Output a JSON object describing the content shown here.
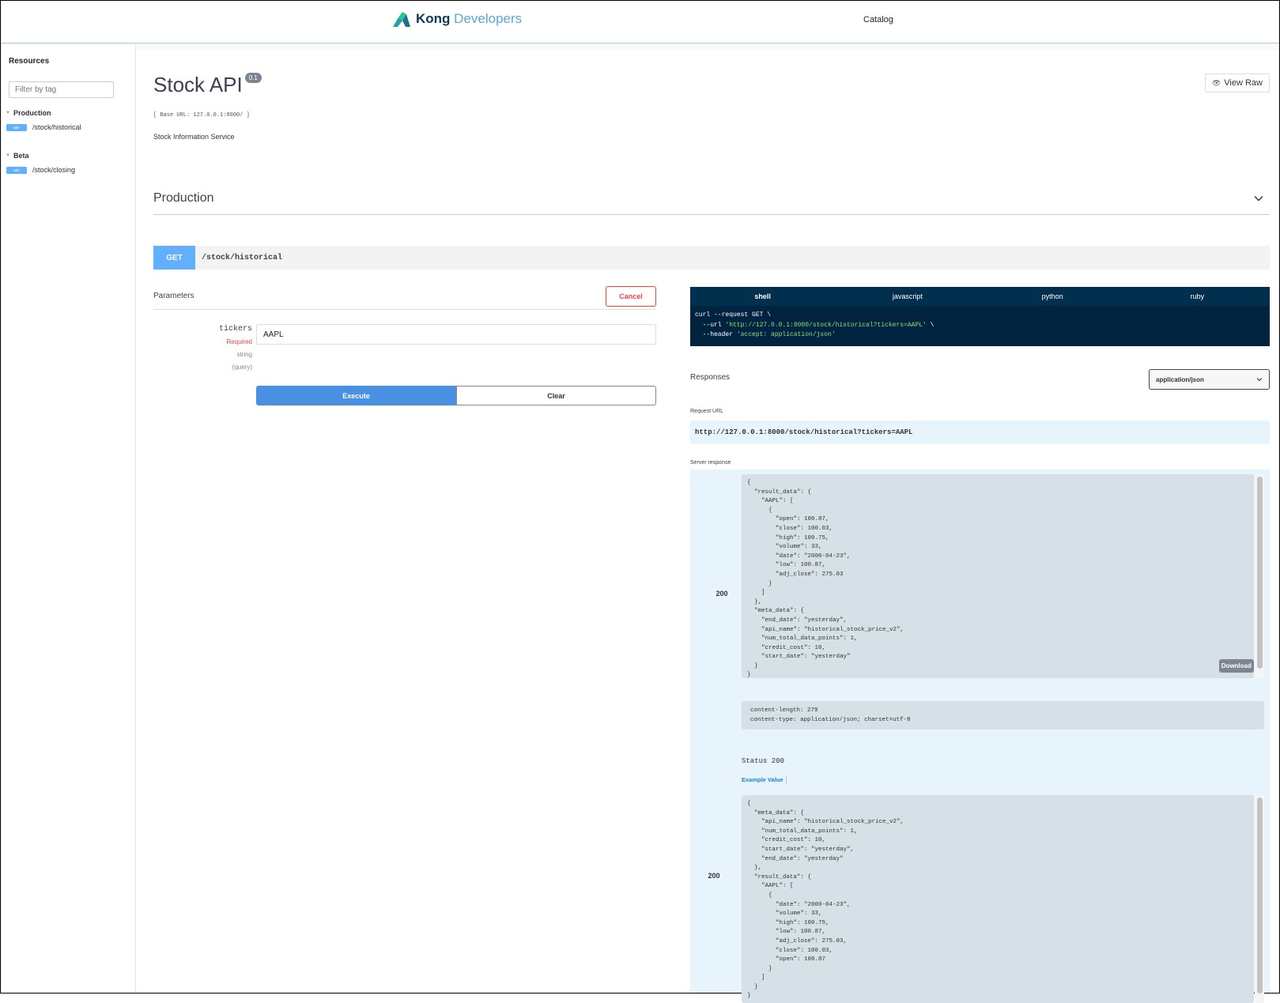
{
  "header": {
    "logo_brand": "Kong",
    "logo_product": " Developers",
    "nav": [
      {
        "label": "Catalog"
      }
    ]
  },
  "sidebar": {
    "title": "Resources",
    "filter_placeholder": "Filter by tag",
    "groups": [
      {
        "label": "Production",
        "items": [
          {
            "method": "GET",
            "path": "/stock/historical"
          }
        ]
      },
      {
        "label": "Beta",
        "items": [
          {
            "method": "GET",
            "path": "/stock/closing"
          }
        ]
      }
    ]
  },
  "api": {
    "title": "Stock API",
    "version": "0.1",
    "view_raw_label": "View Raw",
    "base_url": "[ Base URL: 127.0.0.1:8000/ ]",
    "description": "Stock Information Service"
  },
  "section": {
    "title": "Production",
    "operation": {
      "method": "GET",
      "path": "/stock/historical"
    }
  },
  "parameters": {
    "title": "Parameters",
    "cancel_label": "Cancel",
    "items": [
      {
        "name": "tickers",
        "required": "Required",
        "type": "string",
        "in": "(query)",
        "value": "AAPL"
      }
    ],
    "execute_label": "Execute",
    "clear_label": "Clear"
  },
  "code_samples": {
    "tabs": [
      {
        "label": "shell",
        "active": true
      },
      {
        "label": "javascript",
        "active": false
      },
      {
        "label": "python",
        "active": false
      },
      {
        "label": "ruby",
        "active": false
      }
    ],
    "line1": "curl --request GET \\",
    "line2_prefix": "  --url ",
    "line2_str": "'http://127.0.0.1:8000/stock/historical?tickers=AAPL'",
    "line2_suffix": " \\",
    "line3_prefix": "  --header ",
    "line3_str": "'accept: application/json'"
  },
  "responses": {
    "title": "Responses",
    "content_type": "application/json",
    "request_url_label": "Request URL",
    "request_url": "http://127.0.0.1:8000/stock/historical?tickers=AAPL",
    "server_response_label": "Server response",
    "server_response": {
      "code": "200",
      "body": "{\n  \"result_data\": {\n    \"AAPL\": [\n      {\n        \"open\": 100.87,\n        \"close\": 100.03,\n        \"high\": 100.75,\n        \"volume\": 33,\n        \"date\": \"2000-04-23\",\n        \"low\": 100.87,\n        \"adj_close\": 275.03\n      }\n    ]\n  },\n  \"meta_data\": {\n    \"end_date\": \"yesterday\",\n    \"api_name\": \"historical_stock_price_v2\",\n    \"num_total_data_points\": 1,\n    \"credit_cost\": 10,\n    \"start_date\": \"yesterday\"\n  }\n}",
      "download_label": "Download",
      "headers": "content-length: 279\ncontent-type: application/json; charset=utf-8"
    },
    "documented": {
      "status_heading": "Status 200",
      "example_tab": "Example Value",
      "code": "200",
      "body": "{\n  \"meta_data\": {\n    \"api_name\": \"historical_stock_price_v2\",\n    \"num_total_data_points\": 1,\n    \"credit_cost\": 10,\n    \"start_date\": \"yesterday\",\n    \"end_date\": \"yesterday\"\n  },\n  \"result_data\": {\n    \"AAPL\": [\n      {\n        \"date\": \"2000-04-23\",\n        \"volume\": 33,\n        \"high\": 100.75,\n        \"low\": 100.87,\n        \"adj_close\": 275.03,\n        \"close\": 100.03,\n        \"open\": 100.87\n      }\n    ]\n  }\n}"
    }
  }
}
